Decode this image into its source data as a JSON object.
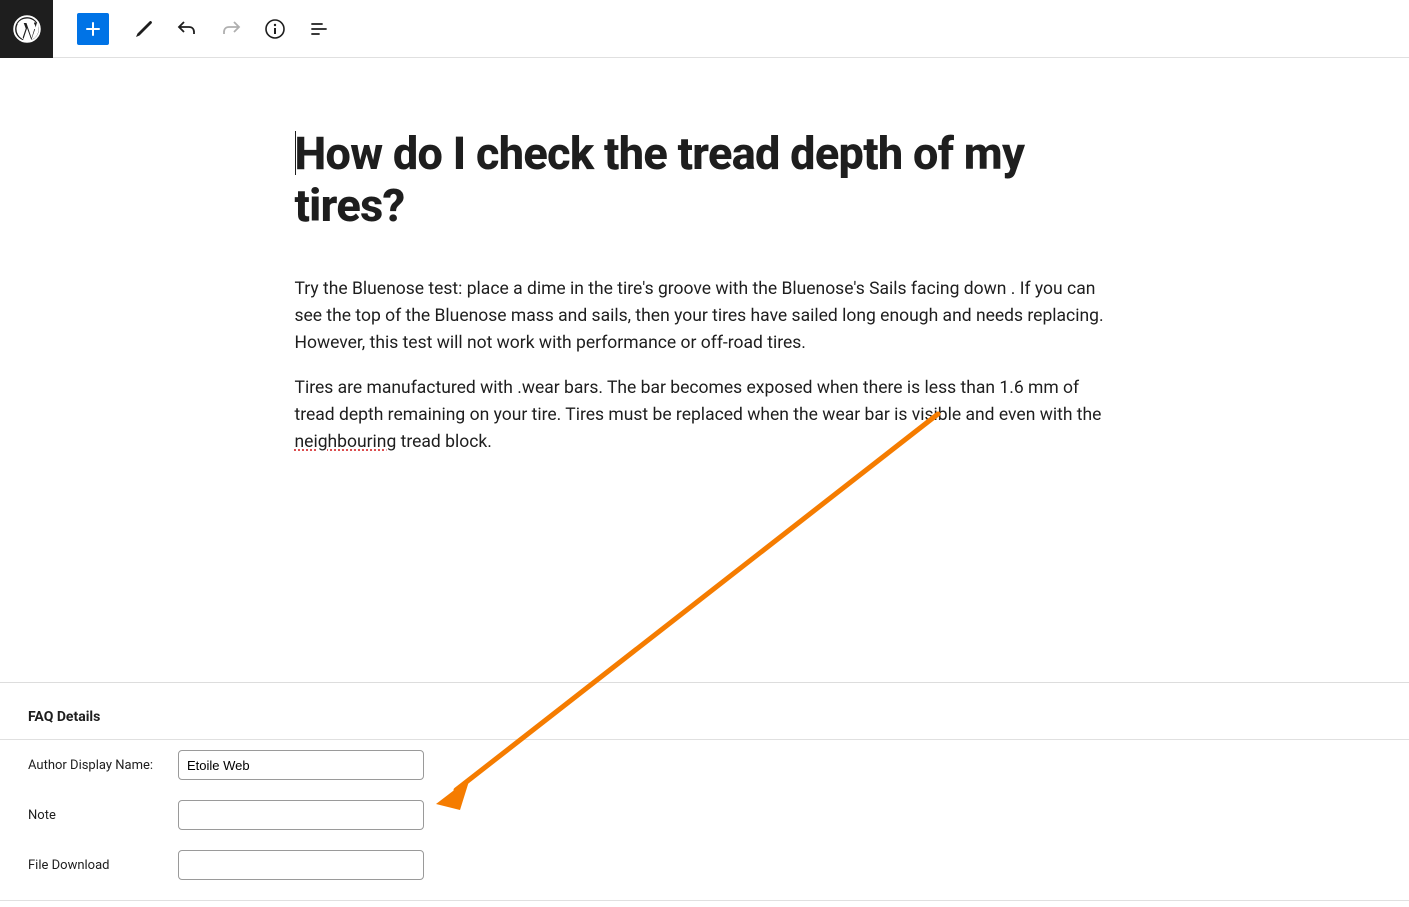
{
  "colors": {
    "accent": "#0073e6",
    "annotation": "#f57c00"
  },
  "editor": {
    "title": "How do I check the tread depth of my tires?",
    "paragraphs": [
      {
        "pre": "Try the Bluenose test: place a dime in the tire's groove with the Bluenose's Sails facing down . If you can see the top of the Bluenose mass and sails, then your tires have sailed long enough and needs replacing. However, this test will not work with performance or off-road tires.",
        "err": "",
        "post": ""
      },
      {
        "pre": "Tires are manufactured with .wear bars. The bar becomes exposed when there is less than 1.6 mm of tread depth remaining on your tire. Tires must be replaced when the wear bar is visible and even with the ",
        "err": "neighbouring",
        "post": " tread block."
      }
    ]
  },
  "meta": {
    "panel_title": "FAQ Details",
    "fields": {
      "author": {
        "label": "Author Display Name:",
        "value": "Etoile Web"
      },
      "note": {
        "label": "Note",
        "value": ""
      },
      "file": {
        "label": "File Download",
        "value": ""
      }
    }
  }
}
